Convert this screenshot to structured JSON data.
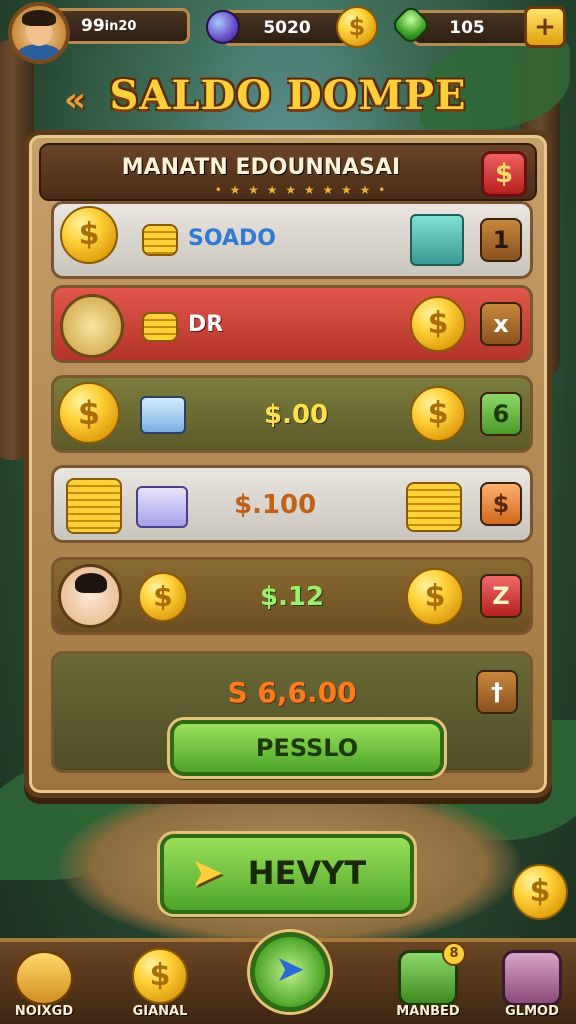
{
  "hud": {
    "player_level": "99",
    "player_level_suffix": "in20",
    "coins": "5020",
    "gems": "105"
  },
  "title": "SALDO DOMPE",
  "panel": {
    "header": "MANATN EDOUNNASAI",
    "stars": "• ★ ★ ★ ★ ★ ★ ★ ★ •",
    "close_symbol": "$",
    "rows": [
      {
        "label": "SOADO",
        "button": "1"
      },
      {
        "label": "DR",
        "button": "x"
      },
      {
        "label": "$.00",
        "button": "6"
      },
      {
        "label": "$.100",
        "button": "$"
      },
      {
        "label": "$.12",
        "button": "Z"
      }
    ],
    "total": "S 6,6.00",
    "total_button": "†",
    "confirm_button": "PESSLO"
  },
  "next_button": "HEVYT",
  "nav": [
    {
      "label": "NOIXGD"
    },
    {
      "label": "GIANAL"
    },
    {
      "label": ""
    },
    {
      "label": "MANBED",
      "badge": "8"
    },
    {
      "label": "GLMOD"
    }
  ],
  "colors": {
    "gold": "#ffcf3a",
    "green_button": "#4ea52a",
    "red_button": "#b52020",
    "panel_wood": "#9c7440"
  }
}
